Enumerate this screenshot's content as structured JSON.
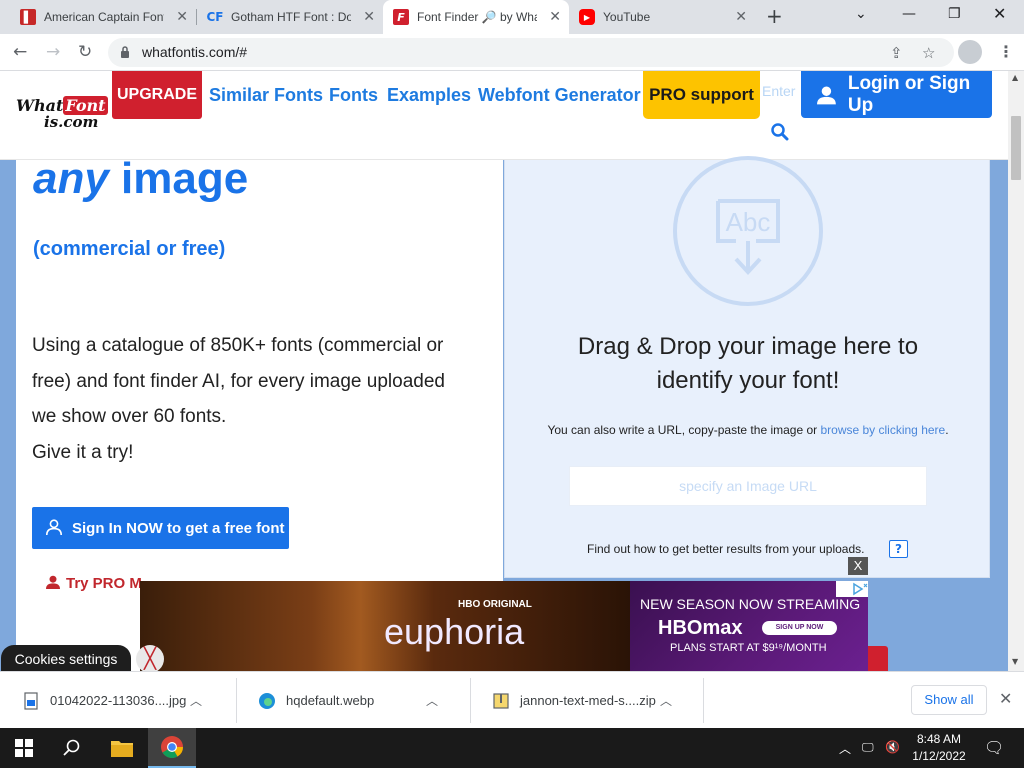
{
  "browser": {
    "tabs": [
      {
        "title": "American Captain Font",
        "favicon": "red-square-icon",
        "active": false
      },
      {
        "title": "Gotham HTF Font : Dow",
        "favicon": "cf-logo-icon",
        "active": false
      },
      {
        "title": "Font Finder 🔎 by Wha",
        "favicon": "whatfontis-favicon",
        "active": true
      },
      {
        "title": "YouTube",
        "favicon": "youtube-icon",
        "active": false
      }
    ],
    "url": "whatfontis.com/#"
  },
  "site": {
    "logo_top": "What",
    "logo_red": "Font",
    "logo_bottom": "is.com",
    "upgrade": "UPGRADE",
    "nav": [
      "Similar Fonts",
      "Fonts",
      "Examples",
      "Webfont Generator"
    ],
    "pro_support": "PRO support",
    "search_placeholder": "Enter",
    "login": "Login or Sign Up"
  },
  "hero": {
    "heading_italic": "any",
    "heading_rest": " image",
    "subheading": "(commercial or free)",
    "body_lines": [
      "Using a catalogue of 850K+ fonts (commercial or",
      "free) and font finder AI, for every image uploaded",
      "we show over 60 fonts.",
      "Give it a try!"
    ],
    "signin_button": "Sign In NOW to get a free font",
    "try_pro": "Try PRO M"
  },
  "dropzone": {
    "icon_text": "Abc",
    "title_line1": "Drag & Drop your image here to",
    "title_line2": "identify your font!",
    "note_prefix": "You can also write a URL, copy-paste the image or ",
    "note_link": "browse by clicking here",
    "note_suffix": ".",
    "url_placeholder": "specify an Image URL",
    "find_out": "Find out how to get better results from your uploads.",
    "help": "?"
  },
  "ad": {
    "brand_small": "HBO ORIGINAL",
    "show": "euphoria",
    "tagline": "NEW SEASON NOW STREAMING",
    "service": "HBOmax",
    "cta": "SIGN UP NOW",
    "price": "PLANS START AT $9¹⁹/MONTH",
    "close": "X"
  },
  "cookies": {
    "label": "Cookies settings"
  },
  "downloads": {
    "items": [
      {
        "name": "01042022-113036....jpg",
        "icon": "image-file-icon"
      },
      {
        "name": "hqdefault.webp",
        "icon": "edge-file-icon"
      },
      {
        "name": "jannon-text-med-s....zip",
        "icon": "zip-file-icon"
      }
    ],
    "show_all": "Show all"
  },
  "taskbar": {
    "time": "8:48 AM",
    "date": "1/12/2022"
  },
  "colors": {
    "brand_blue": "#1a73e8",
    "brand_red": "#d0202e",
    "pro_yellow": "#fdc300"
  }
}
